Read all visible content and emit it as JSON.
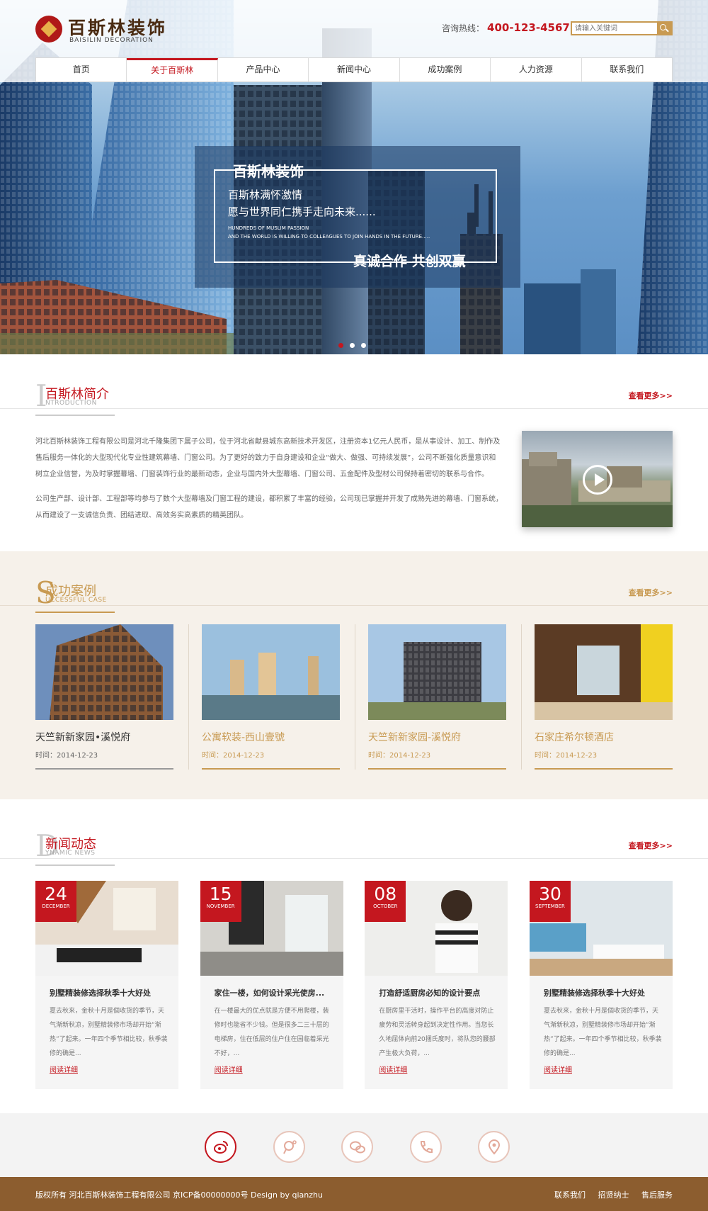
{
  "header": {
    "logo_cn": "百斯林装饰",
    "logo_en": "BAISILIN  DECORATION",
    "hotline_label": "咨询热线：",
    "hotline_number": "400-123-4567",
    "search_placeholder": "请输入关键词"
  },
  "nav": {
    "items": [
      {
        "label": "首页"
      },
      {
        "label": "关于百斯林",
        "active": true
      },
      {
        "label": "产品中心"
      },
      {
        "label": "新闻中心"
      },
      {
        "label": "成功案例"
      },
      {
        "label": "人力资源"
      },
      {
        "label": "联系我们"
      }
    ]
  },
  "banner": {
    "title": "百斯林装饰",
    "line1": "百斯林满怀激情",
    "line2": "愿与世界同仁携手走向未来......",
    "en1": "HUNDREDS OF MUSLIM PASSION",
    "en2": "AND THE WORLD IS WILLING TO COLLEAGUES TO JOIN HANDS IN THE FUTURE.....",
    "slogan": "真诚合作  共创双赢",
    "active_slide": 1,
    "slide_count": 3
  },
  "intro": {
    "big_letter": "I",
    "title": "百斯林简介",
    "subtitle": "NTRODUCTION",
    "more": "查看更多>>",
    "para1": "河北百斯林装饰工程有限公司是河北千隆集团下属子公司，位于河北省献县城东高新技术开发区，注册资本1亿元人民币，是从事设计、加工、制作及售后服务一体化的大型现代化专业性建筑幕墙、门窗公司。为了更好的致力于自身建设和企业“做大、做强、可持续发展”，公司不断强化质量意识和树立企业信誉，为及时掌握幕墙、门窗装饰行业的最新动态，企业与国内外大型幕墙、门窗公司、五金配件及型材公司保持着密切的联系与合作。",
    "para2": "公司生产部、设计部、工程部等均参与了数个大型幕墙及门窗工程的建设，都积累了丰富的经验，公司现已掌握并开发了成熟先进的幕墙、门窗系统，从而建设了一支诚信负责、团结进取、高效务实高素质的精英团队。"
  },
  "cases": {
    "big_letter": "S",
    "title": "成功案例",
    "subtitle": "UCCESSFUL CASE",
    "more": "查看更多>>",
    "items": [
      {
        "title": "天竺新新家园•溪悦府",
        "date": "时间：2014-12-23"
      },
      {
        "title": "公寓软装-西山壹號",
        "date": "时间：2014-12-23"
      },
      {
        "title": "天竺新新家园-溪悦府",
        "date": "时间：2014-12-23"
      },
      {
        "title": "石家庄希尔顿酒店",
        "date": "时间：2014-12-23"
      }
    ]
  },
  "news": {
    "big_letter": "D",
    "title": "新闻动态",
    "subtitle": "YNAMIC NEWS",
    "more": "查看更多>>",
    "items": [
      {
        "day": "24",
        "month": "DECEMBER",
        "title": "别墅精装修选择秋季十大好处",
        "desc": "夏去秋来，金秋十月是個收货的季节，天气渐新秋凉，别墅精装修市场却开始“渐热”了起来。一年四个季节相比较，秋季装修的确是...",
        "read": "阅读详细"
      },
      {
        "day": "15",
        "month": "NOVEMBER",
        "title": "家住一楼，如何设计采光使房...",
        "desc": "在一楼最大的优点就是方便不用爬楼，装修时也能省不少钱。但是很多二三十层的电梯房，住在低层的住户住在园临着采光不好，...",
        "read": "阅读详细"
      },
      {
        "day": "08",
        "month": "OCTOBER",
        "title": "打造舒适厨房必知的设计要点",
        "desc": "在厨房里干活时，操作平台的高度对防止疲劳和灵活转身起到决定性作用。当您长久地屈体向前20捆氏度时，将队您的腰部产生极大负荷，...",
        "read": "阅读详细"
      },
      {
        "day": "30",
        "month": "SEPTEMBER",
        "title": "别墅精装修选择秋季十大好处",
        "desc": "夏去秋来，金秋十月是個收货的季节，天气渐新秋凉，别墅精装修市场却开始“渐热”了起来。一年四个季节相比较，秋季装修的确是...",
        "read": "阅读详细"
      }
    ]
  },
  "social": [
    "weibo-icon",
    "qq-weibo-icon",
    "wechat-icon",
    "phone-icon",
    "location-icon"
  ],
  "footer": {
    "copyright": "版权所有  河北百斯林装饰工程有限公司  京ICP备00000000号  Design by qianzhu",
    "links": [
      "联系我们",
      "招贤纳士",
      "售后服务"
    ]
  },
  "colors": {
    "accent": "#c4171f",
    "gold": "#c89a52",
    "footer": "#8c5d2f"
  }
}
